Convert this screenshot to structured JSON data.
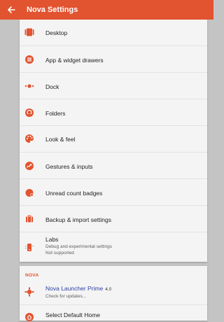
{
  "header": {
    "title": "Nova Settings",
    "back_icon": "arrow-back-icon",
    "background": "#e2532f"
  },
  "menu": [
    {
      "id": "desktop",
      "label": "Desktop",
      "icon": "desktop-icon"
    },
    {
      "id": "app-widget-drawers",
      "label": "App & widget drawers",
      "icon": "app-drawer-icon"
    },
    {
      "id": "dock",
      "label": "Dock",
      "icon": "dock-icon"
    },
    {
      "id": "folders",
      "label": "Folders",
      "icon": "folder-icon"
    },
    {
      "id": "look-feel",
      "label": "Look & feel",
      "icon": "palette-icon"
    },
    {
      "id": "gestures-inputs",
      "label": "Gestures & inputs",
      "icon": "gesture-icon"
    },
    {
      "id": "unread-count-badges",
      "label": "Unread count badges",
      "icon": "badge-icon"
    },
    {
      "id": "backup-import",
      "label": "Backup & import settings",
      "icon": "backup-icon"
    }
  ],
  "labs": {
    "label": "Labs",
    "subtitle_1": "Debug and experimental settings",
    "subtitle_2": "Not supported",
    "icon": "labs-icon"
  },
  "nova_section": {
    "header": "NOVA",
    "prime": {
      "label": "Nova Launcher Prime",
      "version": "4.0",
      "subtitle": "Check for updates...",
      "icon": "nova-prime-icon"
    },
    "default_home": {
      "label": "Select Default Home",
      "icon": "home-icon"
    }
  },
  "colors": {
    "accent": "#e2532f",
    "link": "#2b3fa7",
    "card": "#f4f4f4",
    "background": "#c4c4c4"
  }
}
